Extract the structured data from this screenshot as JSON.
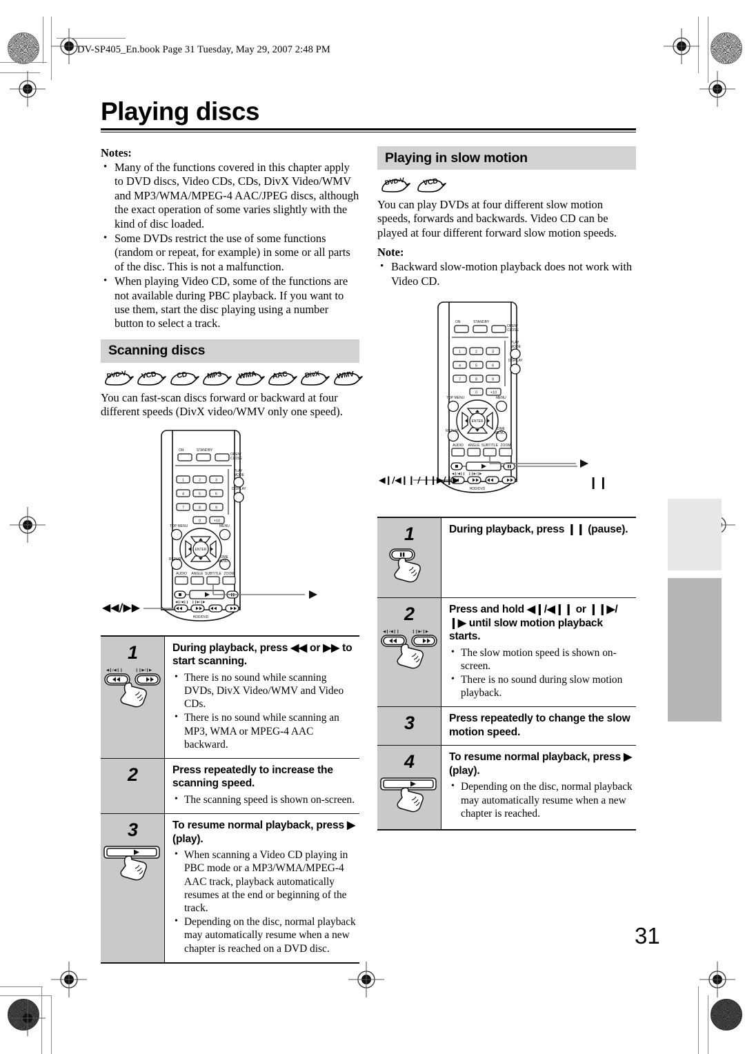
{
  "print": {
    "book_header": "DV-SP405_En.book  Page 31  Tuesday, May 29, 2007  2:48 PM",
    "page_number": "31"
  },
  "title": "Playing discs",
  "left_column": {
    "notes_heading": "Notes:",
    "notes": [
      "Many of the functions covered in this chapter apply to DVD discs, Video CDs, CDs, DivX Video/WMV and MP3/WMA/MPEG-4 AAC/JPEG discs, although the exact operation of some varies slightly with the kind of disc loaded.",
      "Some DVDs restrict the use of some functions (random or repeat, for example) in some or all parts of the disc. This is not a malfunction.",
      "When playing Video CD, some of the functions are not available during PBC playback. If you want to use them, start the disc playing using a number button to select a track."
    ],
    "section_heading": "Scanning discs",
    "badges": [
      "DVD-V",
      "VCD",
      "CD",
      "MP3",
      "WMA",
      "AAC",
      "DivX",
      "WMV"
    ],
    "intro": "You can fast-scan discs forward or backward at four different speeds (DivX video/WMV only one speed).",
    "remote_callouts": {
      "left": "◀◀/▶▶",
      "right": "▶"
    },
    "steps": [
      {
        "number": "1",
        "lead": "During playback, press ◀◀ or ▶▶ to start scanning.",
        "bullets": [
          "There is no sound while scanning DVDs, DivX Video/WMV and Video CDs.",
          "There is no sound while scanning an MP3, WMA or MPEG-4 AAC backward."
        ],
        "art": "scan-buttons",
        "button_labels": [
          "◀❙/◀❙❙",
          "❙❙▶/❙▶"
        ]
      },
      {
        "number": "2",
        "lead": "Press repeatedly to increase the scanning speed.",
        "bullets": [
          "The scanning speed is shown on-screen."
        ],
        "art": "none",
        "button_labels": []
      },
      {
        "number": "3",
        "lead": "To resume normal playback, press ▶ (play).",
        "bullets": [
          "When scanning a Video CD playing in PBC mode or a MP3/WMA/MPEG-4 AAC track, playback automatically resumes at the end or beginning of the track.",
          "Depending on the disc, normal playback may automatically resume when a new chapter is reached on a DVD disc."
        ],
        "art": "play-bar",
        "button_labels": []
      }
    ]
  },
  "right_column": {
    "section_heading": "Playing in slow motion",
    "badges": [
      "DVD-V",
      "VCD"
    ],
    "intro": "You can play DVDs at four different slow motion speeds, forwards and backwards. Video CD can be played at four different forward slow motion speeds.",
    "note_heading": "Note:",
    "notes": [
      "Backward slow-motion playback does not work with Video CD."
    ],
    "remote_callouts": {
      "left": "◀❙/◀❙❙ / ❙❙▶/❙▶",
      "play": "▶",
      "pause": "❙❙"
    },
    "steps": [
      {
        "number": "1",
        "lead": "During playback, press ❙❙ (pause).",
        "bullets": [],
        "art": "pause-button",
        "button_labels": []
      },
      {
        "number": "2",
        "lead": "Press and hold ◀❙/◀❙❙ or ❙❙▶/❙▶ until slow motion playback starts.",
        "bullets": [
          "The slow motion speed is shown on-screen.",
          "There is no sound during slow motion playback."
        ],
        "art": "scan-buttons",
        "button_labels": [
          "◀❙/◀❙❙",
          "❙❙▶/❙▶"
        ]
      },
      {
        "number": "3",
        "lead": "Press repeatedly to change the slow motion speed.",
        "bullets": [],
        "art": "none",
        "button_labels": []
      },
      {
        "number": "4",
        "lead": "To resume normal playback, press ▶ (play).",
        "bullets": [
          "Depending on the disc, normal playback may automatically resume when a new chapter is reached."
        ],
        "art": "play-bar",
        "button_labels": []
      }
    ]
  },
  "remote": {
    "power_labels": [
      "ON",
      "STANDBY",
      "OPEN/ CLOSE"
    ],
    "numbers": [
      "1",
      "2",
      "3",
      "4",
      "5",
      "6",
      "7",
      "8",
      "9",
      "0",
      "+10"
    ],
    "knob_labels": [
      "PLAY MODE",
      "DISPLAY"
    ],
    "menu_labels": [
      "TOP MENU",
      "MENU",
      "RETURN",
      "HOME MENU",
      "ENTER"
    ],
    "feature_labels": [
      "AUDIO",
      "ANGLE",
      "SUBTITLE",
      "ZOOM"
    ],
    "bottom_label": "HDD/DVD"
  },
  "colors": {
    "band_gray": "#d2d2d2",
    "step_gray": "#c9c9c9",
    "tab_light": "#e8e8e8",
    "tab_dark": "#b5b5b5"
  }
}
